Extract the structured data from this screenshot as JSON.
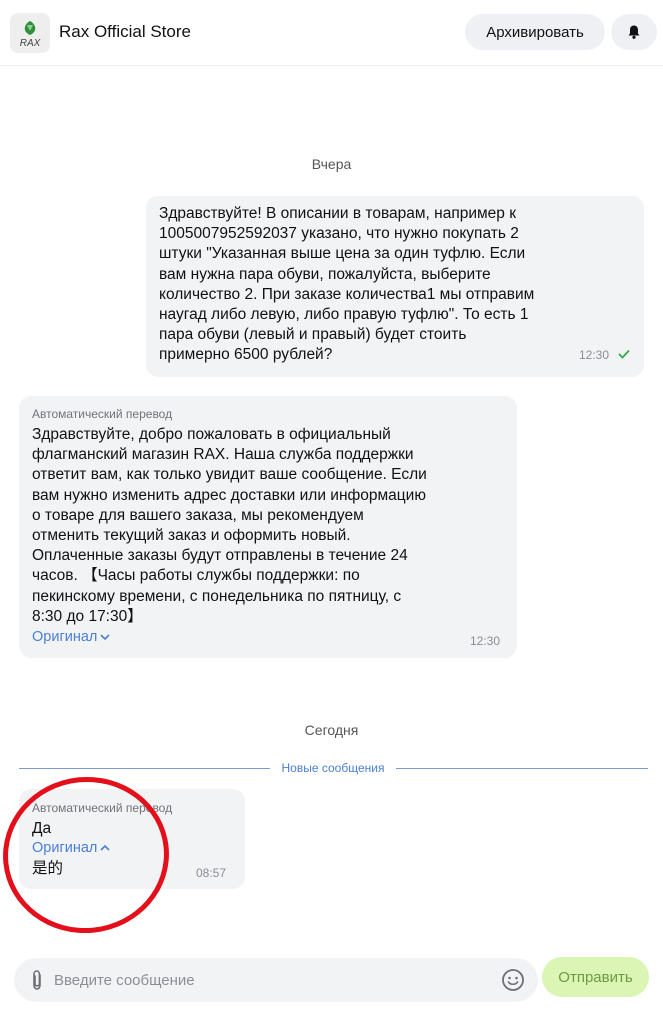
{
  "header": {
    "logo_text": "RAX",
    "store_name": "Rax Official Store",
    "archive_label": "Архивировать",
    "bell_icon": "bell-icon"
  },
  "chat": {
    "date_yesterday": "Вчера",
    "messages": [
      {
        "direction": "outgoing",
        "lines": [
          "Здравствуйте! В описании в товарам, например к",
          "1005007952592037 указано, что нужно покупать 2",
          "штуки \"Указанная выше цена за один туфлю. Если",
          "вам нужна пара обуви, пожалуйста, выберите",
          "количество 2. При заказе количества1 мы отправим",
          "наугад либо левую, либо правую туфлю\". То есть 1",
          "пара обуви (левый и правый) будет стоить",
          "примерно 6500 рублей?"
        ],
        "time": "12:30",
        "status": "read"
      },
      {
        "direction": "incoming",
        "auto_label": "Автоматический перевод",
        "lines": [
          "Здравствуйте, добро пожаловать в официальный",
          "флагманский магазин RAX. Наша служба поддержки",
          "ответит вам, как только увидит ваше сообщение. Если",
          "вам нужно изменить адрес доставки или информацию",
          "о товаре для вашего заказа, мы рекомендуем",
          "отменить текущий заказ и оформить новый.",
          "Оплаченные заказы будут отправлены в течение 24",
          "часов. 【Часы работы службы поддержки: по",
          "пекинскому времени, с понедельника по пятницу, с",
          "8:30 до 17:30】"
        ],
        "original_link": "Оригинал",
        "time": "12:30"
      }
    ],
    "date_today": "Сегодня",
    "new_messages_label": "Новые сообщения",
    "last_message": {
      "direction": "incoming",
      "auto_label": "Автоматический перевод",
      "text": "Да",
      "original_link": "Оригинал",
      "original_text": "是的",
      "time": "08:57"
    }
  },
  "composer": {
    "placeholder": "Введите сообщение",
    "send_label": "Отправить"
  },
  "colors": {
    "bubble_bg": "#f2f3f5",
    "link": "#4a7fd6",
    "read_check": "#2eaa4a",
    "send_bg": "#dbf5b5",
    "send_text": "#6e9a3f",
    "annotation": "#e3101c"
  }
}
